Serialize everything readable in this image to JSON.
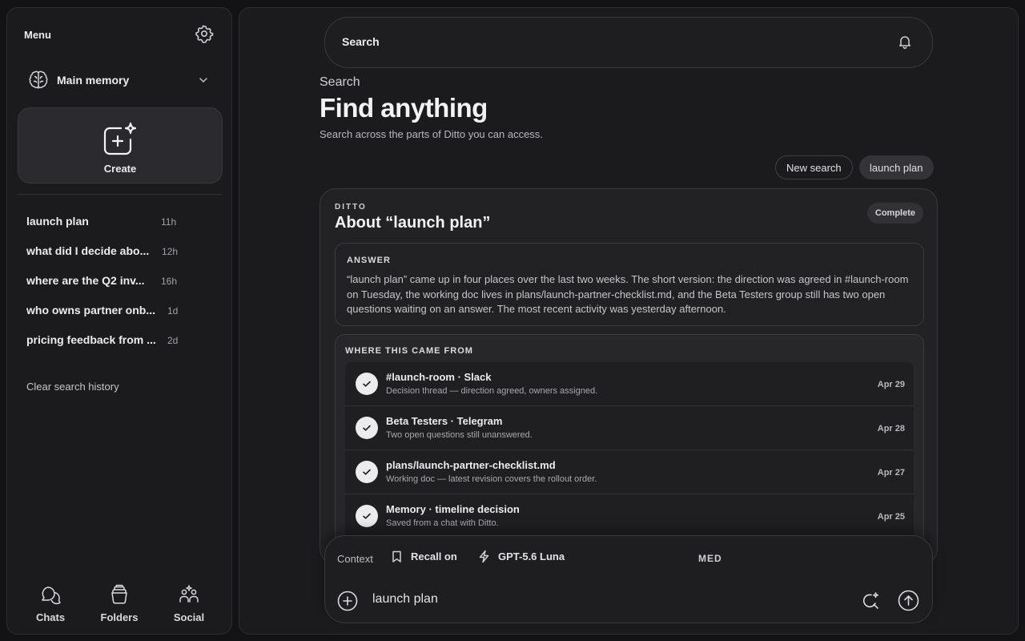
{
  "sidebar": {
    "menu_title": "Menu",
    "memory_label": "Main memory",
    "create_label": "Create",
    "history": [
      {
        "title": "launch plan",
        "age": "11h"
      },
      {
        "title": "what did I decide abo...",
        "age": "12h"
      },
      {
        "title": "where are the Q2 inv...",
        "age": "16h"
      },
      {
        "title": "who owns partner onb...",
        "age": "1d"
      },
      {
        "title": "pricing feedback from ...",
        "age": "2d"
      }
    ],
    "clear_label": "Clear search history",
    "nav": [
      {
        "label": "Chats",
        "icon": "chats-icon"
      },
      {
        "label": "Folders",
        "icon": "folders-icon"
      },
      {
        "label": "Social",
        "icon": "social-icon"
      }
    ]
  },
  "header": {
    "search_label": "Search",
    "eyebrow": "Search",
    "headline": "Find anything",
    "subtext": "Search across the parts of Ditto you can access.",
    "new_search_label": "New search",
    "active_query_label": "launch plan"
  },
  "result": {
    "kicker": "DITTO",
    "title": "About “launch plan”",
    "status": "Complete",
    "answer_label": "ANSWER",
    "answer_text": "“launch plan” came up in four places over the last two weeks. The short version: the direction was agreed in #launch-room on Tuesday, the working doc lives in plans/launch-partner-checklist.md, and the Beta Testers group still has two open questions waiting on an answer. The most recent activity was yesterday afternoon.",
    "sources_label": "WHERE THIS CAME FROM",
    "sources": [
      {
        "title": "#launch-room · Slack",
        "subtitle": "Decision thread — direction agreed, owners assigned.",
        "date": "Apr 29"
      },
      {
        "title": "Beta Testers · Telegram",
        "subtitle": "Two open questions still unanswered.",
        "date": "Apr 28"
      },
      {
        "title": "plans/launch-partner-checklist.md",
        "subtitle": "Working doc — latest revision covers the rollout order.",
        "date": "Apr 27"
      },
      {
        "title": "Memory · timeline decision",
        "subtitle": "Saved from a chat with Ditto.",
        "date": "Apr 25"
      }
    ]
  },
  "composer": {
    "context_label": "Context",
    "recall_label": "Recall on",
    "model_label": "GPT-5.6 Luna",
    "effort_label": "MED",
    "input_value": "launch plan"
  },
  "colors": {
    "background": "#131315",
    "panel": "#1b1b1e",
    "card": "#222225",
    "border": "#38383d",
    "text": "#ececee"
  }
}
